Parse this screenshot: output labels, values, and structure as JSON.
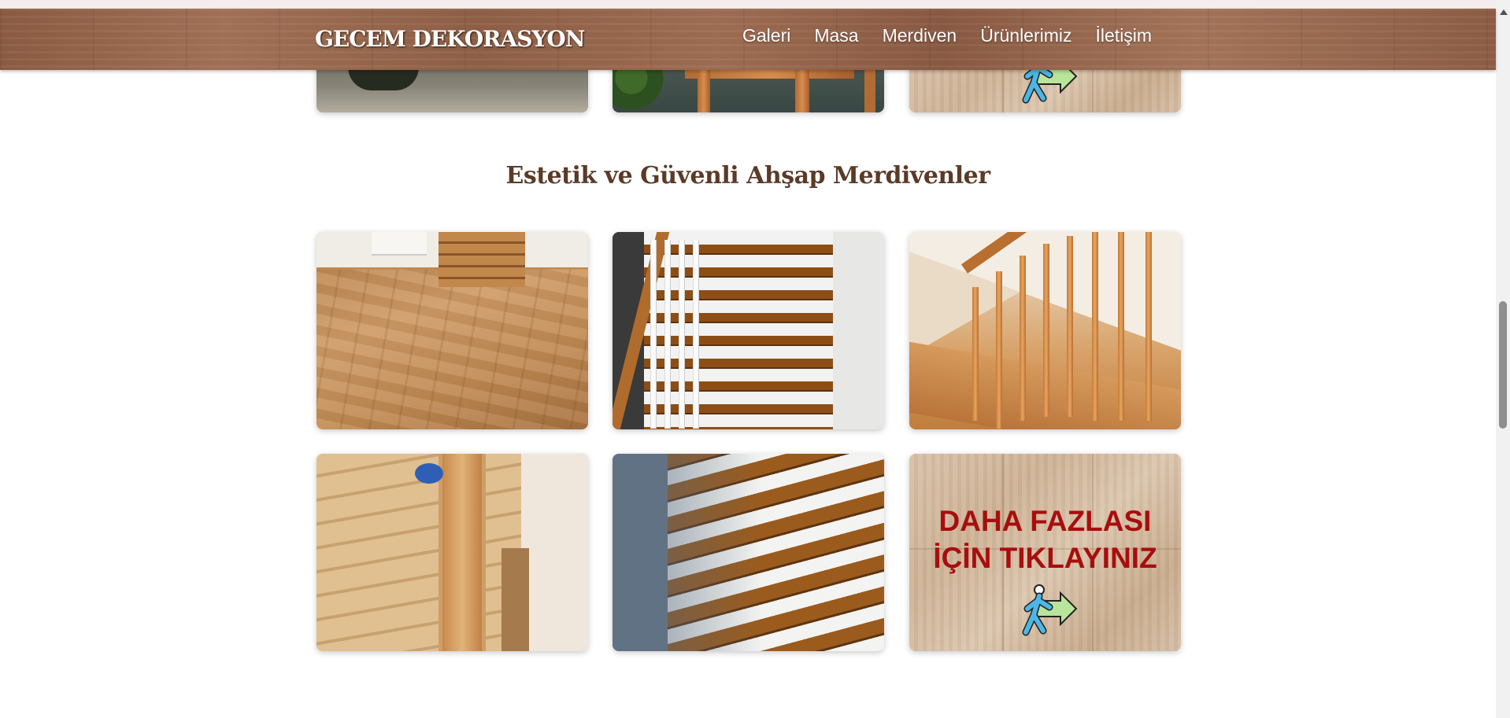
{
  "header": {
    "brand": "GECEM DEKORASYON",
    "nav": [
      "Galeri",
      "Masa",
      "Merdiven",
      "Ürünlerimiz",
      "İletişim"
    ]
  },
  "gallery_top": {
    "items": [
      {
        "alt": "table-photo"
      },
      {
        "alt": "wooden-table-photo"
      },
      {
        "alt": "more-card",
        "icon": "walking-arrow-icon"
      }
    ]
  },
  "stairs_section": {
    "title": "Estetik ve Güvenli Ahşap Merdivenler",
    "more_card": {
      "line1": "DAHA FAZLASI",
      "line2": "İÇİN TIKLAYINIZ",
      "icon": "walking-arrow-icon"
    }
  },
  "colors": {
    "header_wood": "#8a5a41",
    "title": "#5a3b28",
    "more_text": "#a70e0e"
  }
}
